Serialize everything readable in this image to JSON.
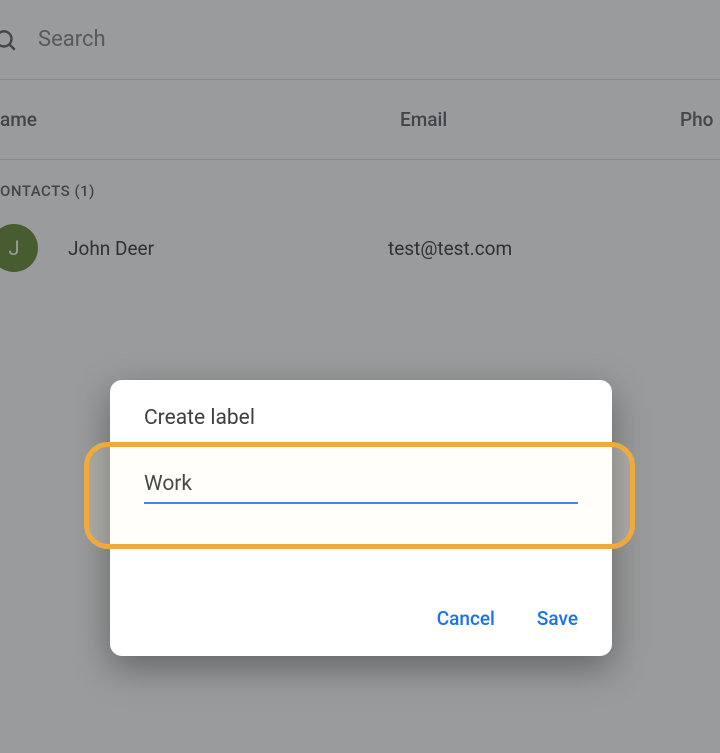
{
  "search": {
    "placeholder": "Search"
  },
  "columns": {
    "name": "ame",
    "email": "Email",
    "phone": "Pho"
  },
  "section": {
    "header": "ONTACTS (1)"
  },
  "contact": {
    "initial": "J",
    "name": "John Deer",
    "email": "test@test.com"
  },
  "dialog": {
    "title": "Create label",
    "input_value": "Work",
    "cancel_label": "Cancel",
    "save_label": "Save"
  }
}
